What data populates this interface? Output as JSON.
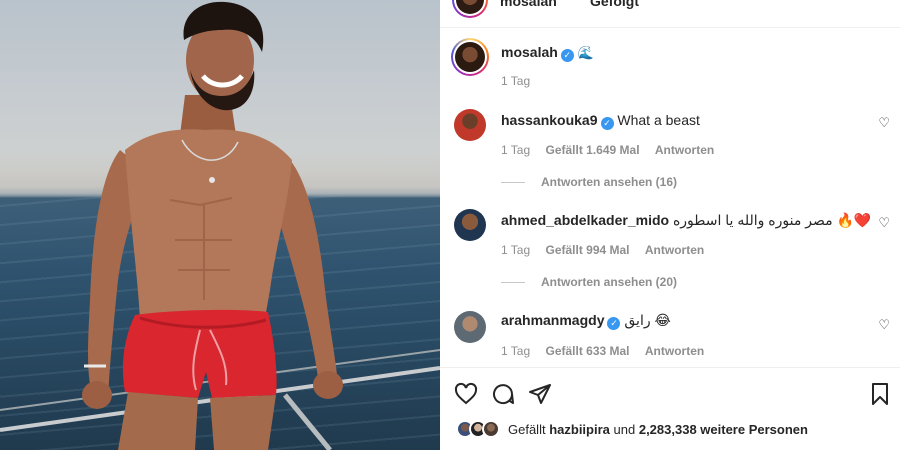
{
  "header": {
    "username": "mosalah",
    "separator": "•",
    "follow_state": "Gefolgt",
    "more": "···"
  },
  "caption": {
    "username": "mosalah",
    "text": "🌊",
    "time": "1 Tag"
  },
  "comments": [
    {
      "username": "hassankouka9",
      "verified": true,
      "text": "What a beast",
      "time": "1 Tag",
      "likes": "Gefällt 1.649 Mal",
      "reply": "Antworten",
      "view_replies": "Antworten ansehen (16)"
    },
    {
      "username": "ahmed_abdelkader_mido",
      "verified": false,
      "text": "مصر منوره والله يا اسطوره 🔥❤️",
      "time": "1 Tag",
      "likes": "Gefällt 994 Mal",
      "reply": "Antworten",
      "view_replies": "Antworten ansehen (20)"
    },
    {
      "username": "arahmanmagdy",
      "verified": true,
      "text": "رايق 😂",
      "time": "1 Tag",
      "likes": "Gefällt 633 Mal",
      "reply": "Antworten"
    }
  ],
  "actions": {
    "like_icon": "heart-icon",
    "comment_icon": "comment-icon",
    "share_icon": "share-icon",
    "save_icon": "bookmark-icon"
  },
  "likes_summary": {
    "prefix": "Gefällt",
    "user": "hazbiipira",
    "middle": "und",
    "count": "2,283,338 weitere Personen"
  },
  "colors": {
    "verified": "#3897f0",
    "muted": "#8e8e8e",
    "text": "#262626"
  }
}
